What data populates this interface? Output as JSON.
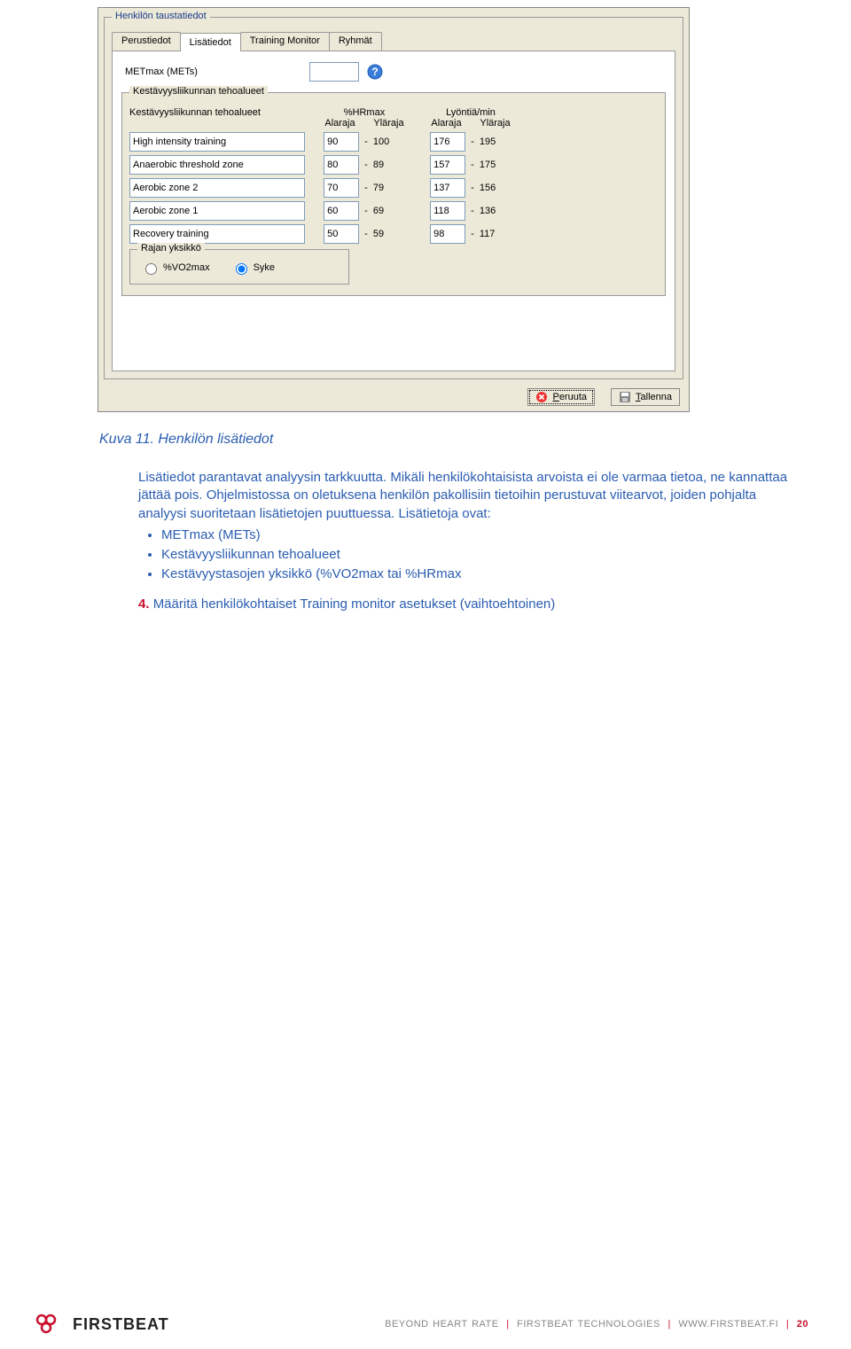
{
  "dialog": {
    "group_title": "Henkilön taustatiedot",
    "tabs": [
      "Perustiedot",
      "Lisätiedot",
      "Training Monitor",
      "Ryhmät"
    ],
    "active_tab": 1,
    "met_label": "METmax (METs)",
    "met_value": "",
    "zones_box_title": "Kestävyysliikunnan tehoalueet",
    "col_name": "Kestävyysliikunnan tehoalueet",
    "col_hr": "%HRmax",
    "col_bpm": "Lyöntiä/min",
    "sub_low": "Alaraja",
    "sub_high": "Yläraja",
    "rows": [
      {
        "name": "High intensity training",
        "hr_low": "90",
        "hr_high": "100",
        "bpm_low": "176",
        "bpm_high": "195"
      },
      {
        "name": "Anaerobic threshold zone",
        "hr_low": "80",
        "hr_high": "89",
        "bpm_low": "157",
        "bpm_high": "175"
      },
      {
        "name": "Aerobic zone 2",
        "hr_low": "70",
        "hr_high": "79",
        "bpm_low": "137",
        "bpm_high": "156"
      },
      {
        "name": "Aerobic zone 1",
        "hr_low": "60",
        "hr_high": "69",
        "bpm_low": "118",
        "bpm_high": "136"
      },
      {
        "name": "Recovery training",
        "hr_low": "50",
        "hr_high": "59",
        "bpm_low": "98",
        "bpm_high": "117"
      }
    ],
    "unit_box_title": "Rajan yksikkö",
    "radio1": "%VO2max",
    "radio2": "Syke",
    "cancel_label": "Peruuta",
    "save_label": "Tallenna"
  },
  "caption": "Kuva 11. Henkilön lisätiedot",
  "body": {
    "p1": "Lisätiedot parantavat analyysin tarkkuutta. Mikäli henkilökohtaisista arvoista ei ole varmaa tietoa, ne kannattaa jättää pois. Ohjelmistossa on oletuksena henkilön pakollisiin tietoihin perustuvat viitearvot, joiden pohjalta analyysi suoritetaan lisätietojen puuttuessa. Lisätietoja ovat:",
    "bullets": [
      "METmax (METs)",
      "Kestävyysliikunnan tehoalueet",
      "Kestävyystasojen yksikkö (%VO2max tai %HRmax"
    ]
  },
  "step4": {
    "num": "4.",
    "text": "Määritä henkilökohtaiset Training monitor asetukset (vaihtoehtoinen)"
  },
  "footer": {
    "brand": "FIRSTBEAT",
    "line_a": "BEYOND HEART RATE",
    "line_b": "FIRSTBEAT TECHNOLOGIES",
    "line_c": "WWW.FIRSTBEAT.FI",
    "page": "20"
  }
}
